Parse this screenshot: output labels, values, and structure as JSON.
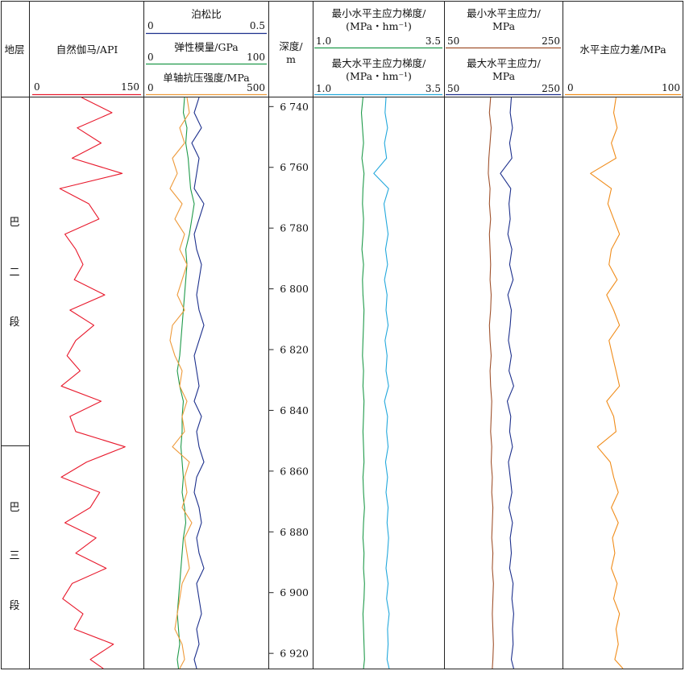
{
  "headers": {
    "formation": "地层",
    "gamma": "自然伽马/API",
    "poisson": "泊松比",
    "modulus": "弹性模量/GPa",
    "ucs": "单轴抗压强度/MPa",
    "depth_line1": "深度/",
    "depth_line2": "m",
    "min_grad_line1": "最小水平主应力梯度/",
    "min_grad_line2": "(MPa・hm⁻¹)",
    "max_grad_line1": "最大水平主应力梯度/",
    "max_grad_line2": "(MPa・hm⁻¹)",
    "min_stress_line1": "最小水平主应力/",
    "min_stress_line2": "MPa",
    "max_stress_line1": "最大水平主应力/",
    "max_stress_line2": "MPa",
    "stress_diff": "水平主应力差/MPa"
  },
  "scales": {
    "gamma": [
      "0",
      "150"
    ],
    "poisson": [
      "0",
      "0.5"
    ],
    "modulus": [
      "0",
      "100"
    ],
    "ucs": [
      "0",
      "500"
    ],
    "min_grad": [
      "1.0",
      "3.5"
    ],
    "max_grad": [
      "1.0",
      "3.5"
    ],
    "min_stress": [
      "50",
      "250"
    ],
    "max_stress": [
      "50",
      "250"
    ],
    "stress_diff": [
      "0",
      "100"
    ]
  },
  "strata": [
    {
      "chars": [
        "巴",
        "二",
        "段"
      ],
      "top": 6740,
      "bottom": 6852.5
    },
    {
      "chars": [
        "巴",
        "三",
        "段"
      ],
      "top": 6852.5,
      "bottom": 6925
    }
  ],
  "colors": {
    "gamma": "#e8192c",
    "poisson": "#1c2f8c",
    "modulus": "#1f9a4a",
    "ucs": "#ee9a3a",
    "min_grad": "#1f9a4a",
    "max_grad": "#22a8dc",
    "min_stress": "#a0522d",
    "max_stress": "#1c2f8c",
    "stress_diff": "#f08c1a"
  },
  "chart_data": {
    "type": "line",
    "orientation": "vertical well log",
    "depth_axis": {
      "label": "深度/m",
      "range": [
        6737,
        6925
      ],
      "ticks": [
        "6 740",
        "6 760",
        "6 780",
        "6 800",
        "6 820",
        "6 840",
        "6 860",
        "6 880",
        "6 900",
        "6 920"
      ],
      "tick_values": [
        6740,
        6760,
        6780,
        6800,
        6820,
        6840,
        6860,
        6880,
        6900,
        6920
      ]
    },
    "depth": [
      6737,
      6742,
      6747,
      6752,
      6757,
      6762,
      6767,
      6772,
      6777,
      6782,
      6787,
      6792,
      6797,
      6802,
      6807,
      6812,
      6817,
      6822,
      6827,
      6832,
      6837,
      6842,
      6847,
      6852,
      6857,
      6862,
      6867,
      6872,
      6877,
      6882,
      6887,
      6892,
      6897,
      6902,
      6907,
      6912,
      6917,
      6922,
      6925
    ],
    "series": [
      {
        "name": "自然伽马/API",
        "track": "gamma",
        "xlim": [
          0,
          150
        ],
        "values": [
          68,
          110,
          62,
          95,
          55,
          124,
          38,
          78,
          92,
          45,
          60,
          70,
          58,
          100,
          52,
          85,
          60,
          48,
          66,
          40,
          95,
          52,
          60,
          128,
          75,
          40,
          93,
          80,
          45,
          88,
          60,
          102,
          55,
          42,
          70,
          58,
          112,
          80,
          98
        ]
      },
      {
        "name": "泊松比",
        "track": "mechanical",
        "xlim": [
          0,
          0.5
        ],
        "values": [
          0.22,
          0.2,
          0.23,
          0.19,
          0.22,
          0.21,
          0.2,
          0.24,
          0.22,
          0.2,
          0.21,
          0.23,
          0.22,
          0.21,
          0.22,
          0.24,
          0.22,
          0.2,
          0.21,
          0.22,
          0.2,
          0.23,
          0.21,
          0.22,
          0.24,
          0.21,
          0.2,
          0.22,
          0.23,
          0.21,
          0.22,
          0.24,
          0.21,
          0.22,
          0.23,
          0.21,
          0.22,
          0.2,
          0.21
        ]
      },
      {
        "name": "弹性模量/GPa",
        "track": "mechanical",
        "xlim": [
          0,
          100
        ],
        "values": [
          32,
          31,
          34,
          33,
          35,
          36,
          37,
          40,
          38,
          36,
          33,
          34,
          33,
          32,
          31,
          30,
          29,
          28,
          26,
          28,
          31,
          30,
          30,
          29,
          30,
          31,
          30,
          32,
          33,
          31,
          30,
          29,
          28,
          27,
          26,
          27,
          28,
          26,
          27
        ]
      },
      {
        "name": "单轴抗压强度/MPa",
        "track": "mechanical",
        "xlim": [
          0,
          500
        ],
        "values": [
          170,
          180,
          140,
          160,
          110,
          130,
          100,
          150,
          120,
          160,
          140,
          170,
          150,
          130,
          160,
          110,
          100,
          120,
          150,
          140,
          170,
          150,
          160,
          110,
          180,
          160,
          170,
          150,
          190,
          160,
          170,
          180,
          150,
          140,
          130,
          120,
          150,
          160,
          140
        ]
      },
      {
        "name": "最小水平主应力梯度",
        "track": "gradient",
        "xlim": [
          1.0,
          3.5
        ],
        "values": [
          1.95,
          1.92,
          1.94,
          1.96,
          1.93,
          1.97,
          1.95,
          1.94,
          1.96,
          1.95,
          1.93,
          1.96,
          1.94,
          1.95,
          1.97,
          1.96,
          1.95,
          1.94,
          1.96,
          1.95,
          1.97,
          1.96,
          1.95,
          1.96,
          1.97,
          1.95,
          1.96,
          1.98,
          1.96,
          1.95,
          1.97,
          1.96,
          1.98,
          1.97,
          1.95,
          1.96,
          1.97,
          1.98,
          1.96
        ]
      },
      {
        "name": "最大水平主应力梯度",
        "track": "gradient",
        "xlim": [
          1.0,
          3.5
        ],
        "values": [
          2.4,
          2.38,
          2.43,
          2.37,
          2.41,
          2.16,
          2.45,
          2.36,
          2.4,
          2.44,
          2.39,
          2.43,
          2.37,
          2.42,
          2.4,
          2.44,
          2.38,
          2.42,
          2.4,
          2.45,
          2.37,
          2.43,
          2.41,
          2.44,
          2.39,
          2.43,
          2.4,
          2.44,
          2.42,
          2.45,
          2.43,
          2.4,
          2.44,
          2.41,
          2.46,
          2.43,
          2.44,
          2.42,
          2.46
        ]
      },
      {
        "name": "最小水平主应力/MPa",
        "track": "stress",
        "xlim": [
          50,
          250
        ],
        "values": [
          128,
          126,
          129,
          127,
          125,
          124,
          127,
          126,
          128,
          126,
          127,
          128,
          127,
          129,
          128,
          126,
          127,
          129,
          127,
          128,
          130,
          129,
          128,
          130,
          129,
          131,
          130,
          132,
          131,
          130,
          132,
          131,
          133,
          132,
          131,
          132,
          133,
          132,
          131
        ]
      },
      {
        "name": "最大水平主应力/MPa",
        "track": "stress",
        "xlim": [
          50,
          250
        ],
        "values": [
          164,
          162,
          166,
          161,
          165,
          145,
          163,
          160,
          162,
          158,
          165,
          161,
          167,
          158,
          164,
          162,
          159,
          164,
          160,
          168,
          157,
          163,
          161,
          166,
          159,
          162,
          165,
          160,
          166,
          162,
          164,
          161,
          167,
          165,
          168,
          166,
          167,
          164,
          168
        ]
      },
      {
        "name": "水平主应力差/MPa",
        "track": "diff",
        "xlim": [
          0,
          100
        ],
        "values": [
          44,
          42,
          45,
          40,
          44,
          22,
          40,
          37,
          42,
          47,
          40,
          38,
          45,
          36,
          42,
          47,
          38,
          41,
          44,
          47,
          36,
          42,
          44,
          28,
          39,
          42,
          46,
          40,
          46,
          41,
          43,
          40,
          45,
          42,
          47,
          44,
          46,
          43,
          50
        ]
      }
    ]
  }
}
